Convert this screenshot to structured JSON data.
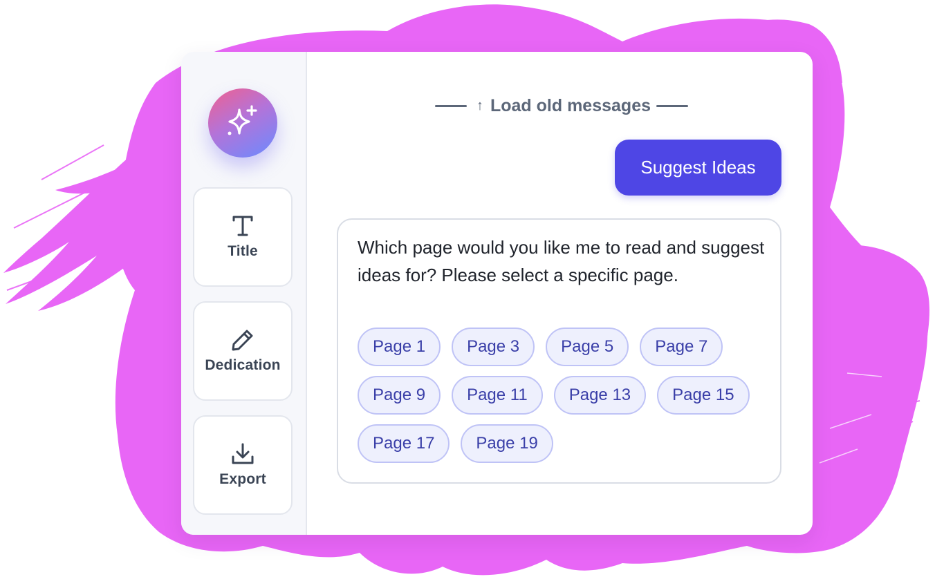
{
  "colors": {
    "background_blob": "#e866f6",
    "accent": "#4e46e5",
    "chip_bg": "#eef0fd",
    "chip_border": "#bfc3f6",
    "chip_text": "#3a3fa8",
    "sidebar_bg": "#f6f7fb",
    "orb_gradient": [
      "#f0608e",
      "#b473d8",
      "#6a8bff"
    ]
  },
  "sidebar": {
    "ai_button_icon": "sparkles-icon",
    "items": [
      {
        "label": "Title",
        "icon": "text-t-icon"
      },
      {
        "label": "Dedication",
        "icon": "pencil-icon"
      },
      {
        "label": "Export",
        "icon": "download-icon"
      }
    ]
  },
  "chat": {
    "load_old_label": "Load old messages",
    "load_old_icon": "arrow-up-icon",
    "user_message": "Suggest Ideas",
    "assistant_message": "Which page would you like me to read and suggest ideas for? Please select a specific page.",
    "page_options": [
      [
        "Page 1",
        "Page 3",
        "Page 5",
        "Page 7"
      ],
      [
        "Page 9",
        "Page 11",
        "Page 13",
        "Page 15"
      ],
      [
        "Page 17",
        "Page 19"
      ]
    ]
  }
}
